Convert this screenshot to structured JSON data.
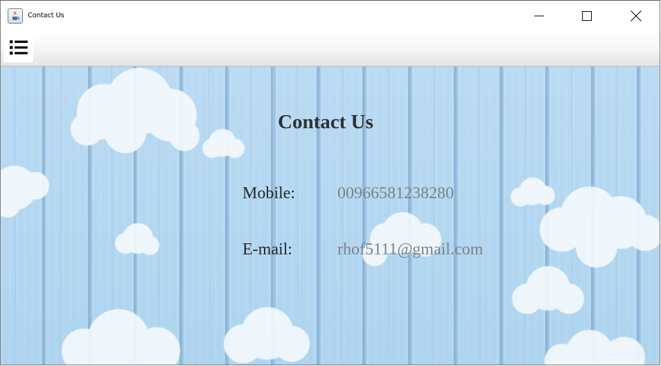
{
  "window": {
    "title": "Contact Us",
    "app_icon": "java-coffee-icon"
  },
  "window_controls": {
    "minimize": "minimize-icon",
    "maximize": "maximize-icon",
    "close": "close-icon"
  },
  "toolbar": {
    "menu_icon": "list-menu-icon"
  },
  "content": {
    "heading": "Contact Us",
    "mobile_label": "Mobile:",
    "mobile_value": "00966581238280",
    "email_label": "E-mail:",
    "email_value": "rhof5111@gmail.com"
  },
  "colors": {
    "background_sky": "#b3d7f0",
    "heading_text": "#2f3133",
    "label_text": "#262829",
    "value_text": "#7e8286"
  }
}
